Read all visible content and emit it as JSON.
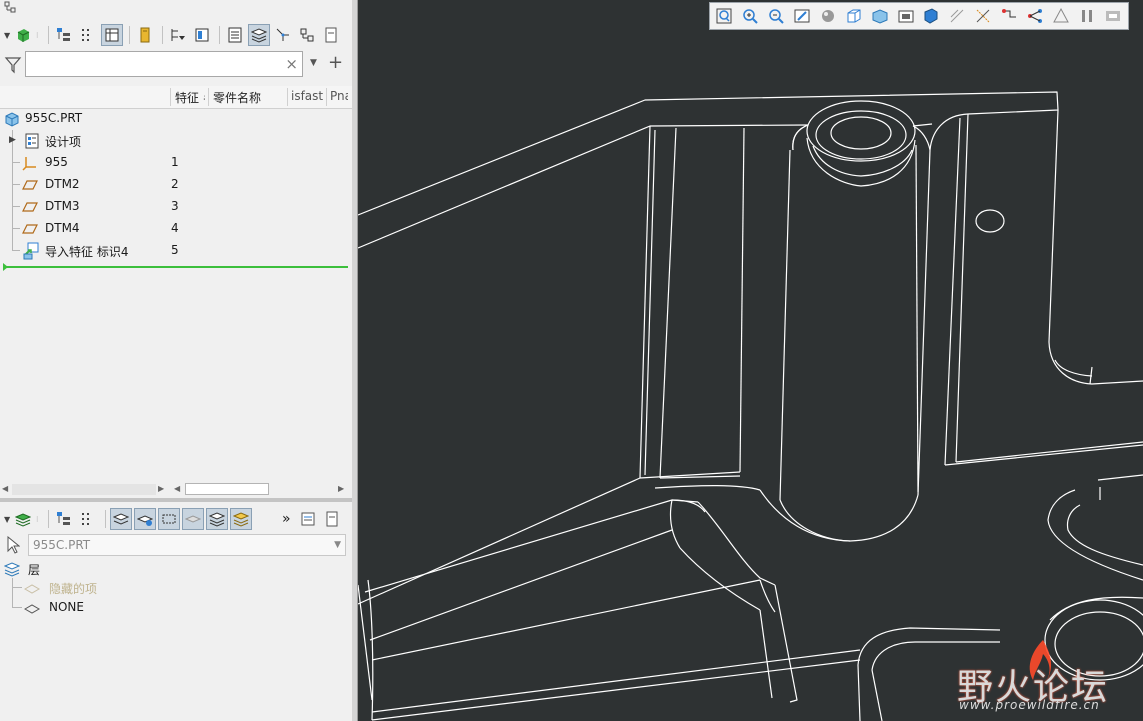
{
  "model_tree": {
    "columns": [
      "特征 #",
      "零件名称",
      "isfast",
      "Pna"
    ],
    "filter": {
      "value": "",
      "clear_icon": "×"
    },
    "items": [
      {
        "label": "955C.PRT",
        "num": "",
        "icon": "part-icon"
      },
      {
        "label": "设计项",
        "num": "",
        "icon": "design-items-icon"
      },
      {
        "label": "955",
        "num": "1",
        "icon": "csys-icon"
      },
      {
        "label": "DTM2",
        "num": "2",
        "icon": "datum-plane-icon"
      },
      {
        "label": "DTM3",
        "num": "3",
        "icon": "datum-plane-icon"
      },
      {
        "label": "DTM4",
        "num": "4",
        "icon": "datum-plane-icon"
      },
      {
        "label": "导入特征 标识4",
        "num": "5",
        "icon": "import-feature-icon"
      }
    ]
  },
  "layer_tree": {
    "model": "955C.PRT",
    "root": "层",
    "items": [
      {
        "label": "隐藏的项",
        "dim": true
      },
      {
        "label": "NONE",
        "dim": false
      }
    ],
    "more_label": "»"
  },
  "watermark": {
    "title": "野火论坛",
    "url": "www.proewildfire.cn"
  },
  "colors": {
    "viewport": "#2e3233",
    "edges": "#ffffff",
    "insert_line": "#3cbf3c",
    "watermark_fire": "#ff4a2a"
  }
}
